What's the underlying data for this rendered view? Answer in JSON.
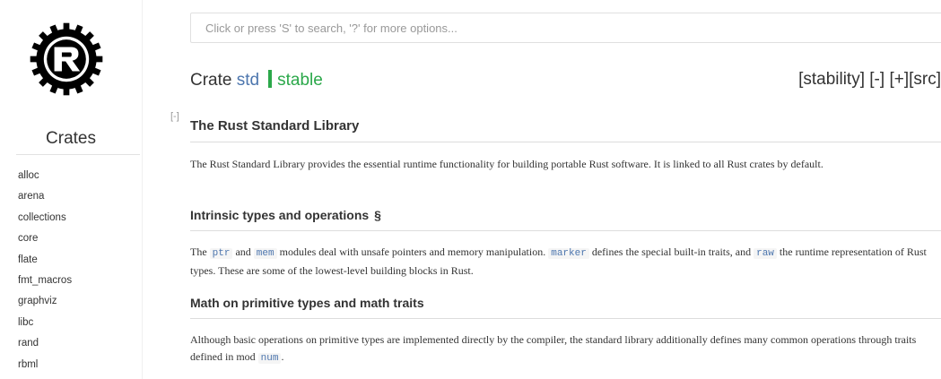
{
  "sidebar": {
    "logo_icon": "rust-gear-logo-icon",
    "crates_heading": "Crates",
    "crates": [
      "alloc",
      "arena",
      "collections",
      "core",
      "flate",
      "fmt_macros",
      "graphviz",
      "libc",
      "rand",
      "rbml"
    ]
  },
  "search": {
    "placeholder": "Click or press 'S' to search, '?' for more options..."
  },
  "header": {
    "prefix": "Crate",
    "crate_name": "std",
    "stability_label": "stable",
    "links": {
      "stability": "[stability]",
      "collapse": "[-]",
      "expand": "[+]",
      "src": "[src]"
    }
  },
  "doc": {
    "collapse_toggle": "[-]",
    "title": "The Rust Standard Library",
    "intro": "The Rust Standard Library provides the essential runtime functionality for building portable Rust software. It is linked to all Rust crates by default.",
    "sections": [
      {
        "heading": "Intrinsic types and operations",
        "anchor": "§",
        "text": {
          "t1": "The ",
          "c1": "ptr",
          "t2": " and ",
          "c2": "mem",
          "t3": " modules deal with unsafe pointers and memory manipulation. ",
          "c3": "marker",
          "t4": " defines the special built-in traits, and ",
          "c4": "raw",
          "t5": " the runtime representation of Rust types. These are some of the lowest-level building blocks in Rust."
        }
      },
      {
        "heading": "Math on primitive types and math traits",
        "text": {
          "t1": "Although basic operations on primitive types are implemented directly by the compiler, the standard library additionally defines many common operations through traits defined in mod ",
          "c1": "num",
          "t2": "."
        }
      }
    ]
  },
  "colors": {
    "link": "#4d76ae",
    "stable": "#2ba84a",
    "text": "#333333"
  }
}
